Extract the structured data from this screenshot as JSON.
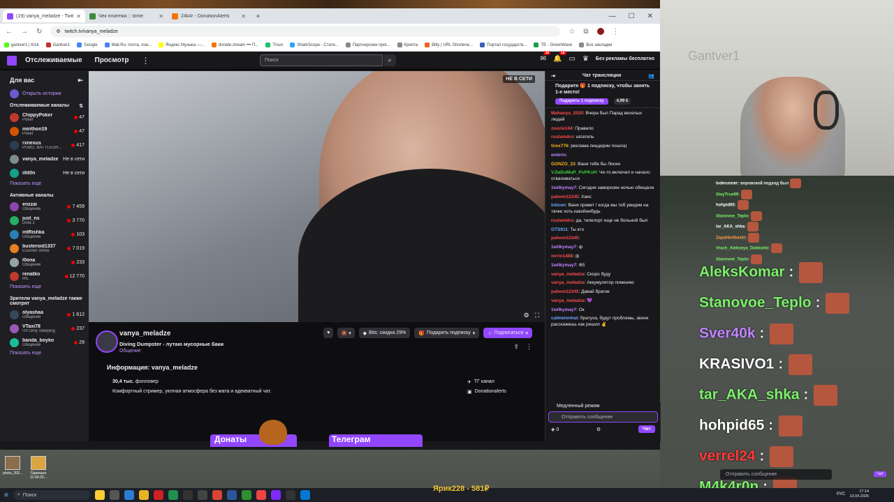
{
  "browser": {
    "tabs": [
      {
        "label": "(19) vanya_meladze - Twitch",
        "color": "#9147ff",
        "active": true
      },
      {
        "label": "Чек платежа :: tome",
        "color": "#3c8c3c",
        "active": false
      },
      {
        "label": "24k4r - DonationAlerts",
        "color": "#f57507",
        "active": false
      }
    ],
    "new_tab": "+",
    "url": "twitch.tv/vanya_meladze",
    "bookmarks": [
      "gantver1 | Kick",
      "Gantver1",
      "Google",
      "Mail.Ru: почта, пои...",
      "Яндекс Музыка —...",
      "donate.stream ••• П...",
      "Trovo",
      "SharkScope - Стати...",
      "Партнерские прог...",
      "Крипта",
      "Bitly | URL Shortene...",
      "Портал государств...",
      "TE - GreenWave",
      "Все закладки"
    ]
  },
  "twitch_nav": {
    "following": "Отслеживаемые",
    "browse": "Просмотр",
    "more": "⋮",
    "search_placeholder": "Поиск",
    "notif_badge_1": "36",
    "notif_badge_2": "19",
    "prime": "Без рекламы бесплатно"
  },
  "sidebar": {
    "for_you": "Для вас",
    "open_history": "Открыть истории",
    "followed_title": "Отслеживаемые каналы",
    "followed": [
      {
        "name": "ChippyPoker",
        "game": "Poker",
        "count": "47",
        "live": true
      },
      {
        "name": "minthon19",
        "game": "Poker",
        "count": "47",
        "live": true
      },
      {
        "name": "rxnexus",
        "game": "PUBG: BATTLEGR...",
        "count": "417",
        "live": true
      },
      {
        "name": "vanya_meladze",
        "game": "",
        "count": "Не в сети",
        "live": false
      },
      {
        "name": "illit0n",
        "game": "",
        "count": "Не в сети",
        "live": false
      }
    ],
    "show_more_1": "Показать еще",
    "active_title": "Активные каналы",
    "active": [
      {
        "name": "enzzai",
        "game": "Общение",
        "count": "7 459"
      },
      {
        "name": "just_ns",
        "game": "Dota 2",
        "count": "3 770"
      },
      {
        "name": "intRishka",
        "game": "Общение",
        "count": "103"
      },
      {
        "name": "busteroid1337",
        "game": "Counter-Strike",
        "count": "7 019"
      },
      {
        "name": "l0ona",
        "game": "Общение",
        "count": "233"
      },
      {
        "name": "renatko",
        "game": "IRL",
        "count": "12 770"
      }
    ],
    "show_more_2": "Показать еще",
    "also_title": "Зрители vanya_meladze также смотрят",
    "also": [
      {
        "name": "olyashaa",
        "game": "Общение",
        "count": "1 612"
      },
      {
        "name": "VTaxi78",
        "game": "I'm Only Sleeping",
        "count": "237"
      },
      {
        "name": "banda_boyko",
        "game": "Общение",
        "count": "29"
      }
    ],
    "show_more_3": "Показать еще"
  },
  "video": {
    "offline_badge": "НЕ В СЕТИ"
  },
  "channel": {
    "name": "vanya_meladze",
    "title": "Diving Dumpster - лутаю мусорные баки",
    "category": "Общение",
    "bits": "Bits: скидка 29%",
    "gift_sub": "Подарить подписку",
    "subscribe": "Подписаться",
    "about_title": "Информация: vanya_meladze",
    "followers_num": "30,4 тыс.",
    "followers_label": "фолловер",
    "description": "Комфортный стример, уютная атмосфера без мата и адекватный чат.",
    "link_1": "ТГ канал",
    "link_2": "Donationalerts",
    "panel_1": "Донаты",
    "panel_2": "Телеграм"
  },
  "chat": {
    "title": "Чат трансляции",
    "promo": "Подарите 🎁 1 подписку, чтобы занять 1-е место!",
    "promo_btn": "Подарить 1 подписку",
    "promo_price": "4,99 €",
    "messages": [
      {
        "user": "Mahanya_2020",
        "color": "#ff4a4a",
        "text": ": Вчера был Парад веселых людей"
      },
      {
        "user": "zoozie144",
        "color": "#ff4a4a",
        "text": ": Правило"
      },
      {
        "user": "rustamdro",
        "color": "#ff4a4a",
        "text": ": шпатель"
      },
      {
        "user": "tirex776",
        "color": "#ffb31a",
        "text": ": реклама пиццерии пошла)"
      },
      {
        "user": "enteris",
        "color": "#c184ff",
        "text": ":"
      },
      {
        "user": "GONZO_23",
        "color": "#ffb31a",
        "text": ": Ваня тебе бы Лисян"
      },
      {
        "user": "VJIaDuMuP_PuPKuH",
        "color": "#3ad03a",
        "text": ": Че-то включил и начало отваливаться"
      },
      {
        "user": "1wilkymay7",
        "color": "#c184ff",
        "text": ": Сегодня заморозки ночью обещали"
      },
      {
        "user": "pahom12345",
        "color": "#ff4a4a",
        "text": ": Ханс"
      },
      {
        "user": "inticen",
        "color": "#6fa8ff",
        "text": ": Ваня привет ! когда мы теб увидим на тачке хоть какойнибудь"
      },
      {
        "user": "rustamdro",
        "color": "#ff4a4a",
        "text": ": да, телепорт еще не больной был"
      },
      {
        "user": "GTS911",
        "color": "#6fa8ff",
        "text": ": Ты кто"
      },
      {
        "user": "pahom12345",
        "color": "#ff4a4a",
        "text": ":"
      },
      {
        "user": "1wilkymay7",
        "color": "#c184ff",
        "text": ": ф"
      },
      {
        "user": "mrrio1488",
        "color": "#ff4a4a",
        "text": ": ф"
      },
      {
        "user": "1wilkymay7",
        "color": "#c184ff",
        "text": ": Ф5"
      },
      {
        "user": "vanya_meladze",
        "color": "#ff4a4a",
        "text": ": Скоро буду"
      },
      {
        "user": "vanya_meladze",
        "color": "#ff4a4a",
        "text": ": Аккумулятор поменяю"
      },
      {
        "user": "pahom12345",
        "color": "#ff4a4a",
        "text": ": Давай братик"
      },
      {
        "user": "vanya_meladze",
        "color": "#ff4a4a",
        "text": ": 💜"
      },
      {
        "user": "1wilkymay7",
        "color": "#c184ff",
        "text": ": Ок"
      },
      {
        "user": "catmelonhat",
        "color": "#6fa8ff",
        "text": ": братуха, будут проблемы, звони расскажешь как решил ✌"
      }
    ],
    "slow_mode": "Медленный режим",
    "input_placeholder": "Отправить сообщение",
    "points": "0",
    "send": "Чат"
  },
  "webcam": {
    "logo": "Gantver1"
  },
  "overlay": {
    "small": [
      {
        "user": "loderunner",
        "text": ": воровской подход был",
        "color": "#ffffff"
      },
      {
        "user": "StayTrue89",
        "text": ":",
        "color": "#7cf06a"
      },
      {
        "user": "hohpid65",
        "text": ":",
        "color": "#ffffff"
      },
      {
        "user": "Stanovoe_Teplo",
        "text": ":",
        "color": "#7cf06a"
      },
      {
        "user": "tar_AKA_shka",
        "text": ":",
        "color": "#ffffff"
      },
      {
        "user": "Zapahkolbaski",
        "text": ":",
        "color": "#ff9b4a"
      },
      {
        "user": "Vrach_Alekseya_Dokkorki",
        "text": ":",
        "color": "#7cf06a"
      },
      {
        "user": "Stanovoe_Teplo",
        "text": ":",
        "color": "#7cf06a"
      }
    ],
    "big": [
      {
        "user": "AleksKomar",
        "color": "#7cf06a"
      },
      {
        "user": "Stanovoe_Teplo",
        "color": "#7cf06a"
      },
      {
        "user": "Sver40k",
        "color": "#c184ff"
      },
      {
        "user": "KRASIVO1",
        "color": "#ffffff"
      },
      {
        "user": "tar_AKA_shka",
        "color": "#7cf06a"
      },
      {
        "user": "hohpid65",
        "color": "#ffffff"
      },
      {
        "user": "verrel24",
        "color": "#ff3b3b"
      },
      {
        "user": "M4k4r0n",
        "color": "#7cf06a"
      }
    ],
    "input_placeholder": "Отправить сообщение",
    "chat_btn": "Чат"
  },
  "desktop": {
    "icon_1": "photo_202...",
    "icon_2": "Скриншот 11-04-20..."
  },
  "taskbar": {
    "search": "Поиск",
    "ticker": "Ярик228 - 581₽",
    "time": "17:14",
    "date": "13.04.2026",
    "lang": "РУС"
  }
}
